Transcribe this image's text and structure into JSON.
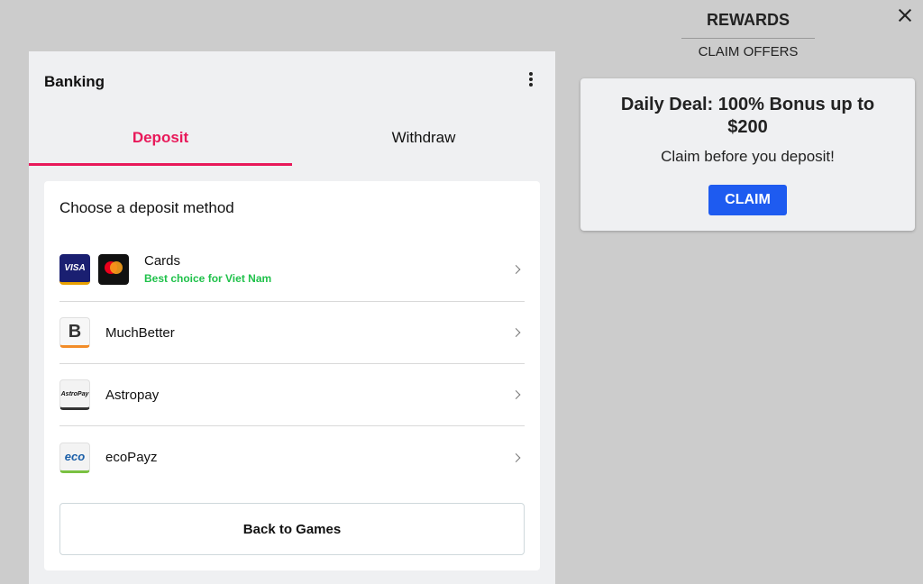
{
  "banking": {
    "title": "Banking",
    "tabs": [
      {
        "label": "Deposit",
        "active": true
      },
      {
        "label": "Withdraw",
        "active": false
      }
    ],
    "heading": "Choose a deposit method",
    "methods": [
      {
        "name": "Cards",
        "subtitle": "Best choice for Viet Nam",
        "icons": [
          "visa-logo",
          "mastercard-logo"
        ]
      },
      {
        "name": "MuchBetter",
        "icons": [
          "muchbetter-logo"
        ]
      },
      {
        "name": "Astropay",
        "icons": [
          "astropay-logo"
        ]
      },
      {
        "name": "ecoPayz",
        "icons": [
          "ecopayz-logo"
        ]
      }
    ],
    "logo_text": {
      "visa": "VISA",
      "muchbetter": "B",
      "astropay": "AstroPay",
      "eco": "eco"
    },
    "back_button": "Back to Games",
    "accent_color": "#e8195a",
    "subtitle_color": "#1fc14a"
  },
  "rewards": {
    "title": "REWARDS",
    "claim_offers": "CLAIM OFFERS",
    "offer": {
      "title": "Daily Deal: 100% Bonus up to $200",
      "subtitle": "Claim before you deposit!",
      "button": "CLAIM",
      "button_color": "#1e5bf0"
    }
  }
}
